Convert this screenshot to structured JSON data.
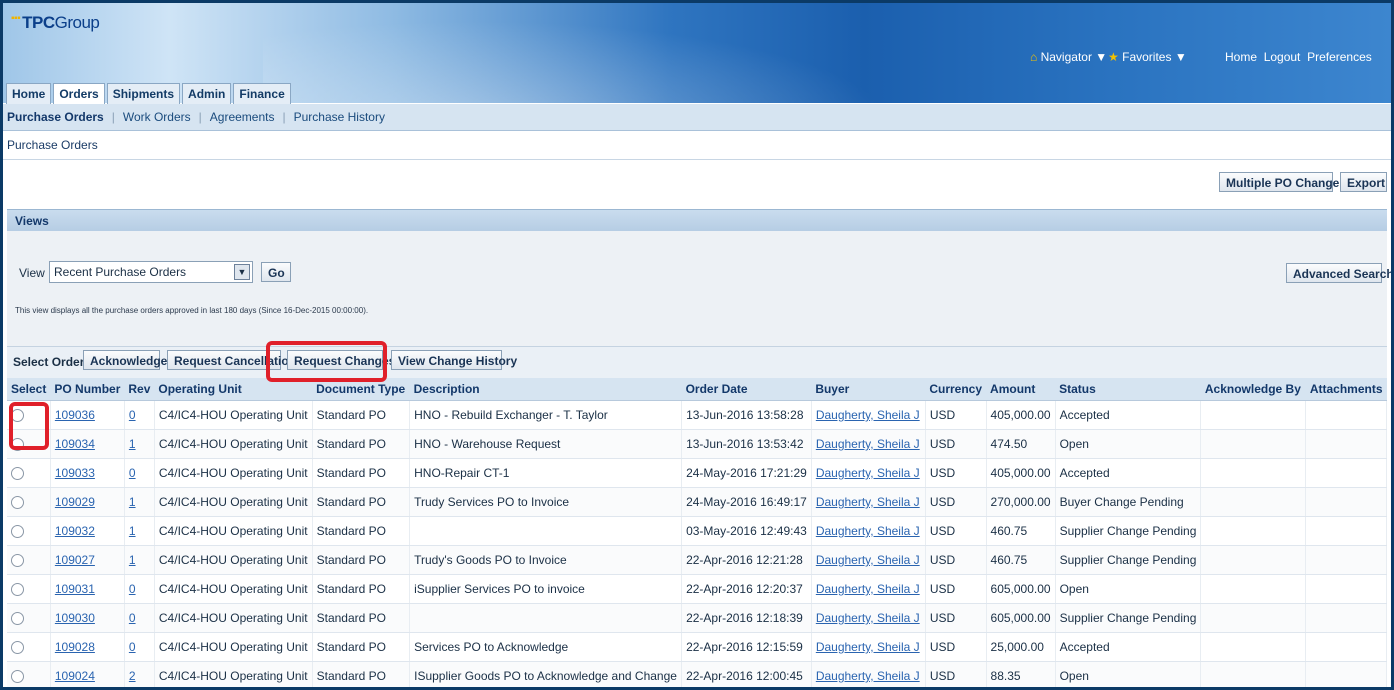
{
  "app": {
    "logo_text": "TPC",
    "logo_suffix": "Group",
    "navigator": "Navigator",
    "favorites": "Favorites",
    "global_links": [
      "Home",
      "Logout",
      "Preferences"
    ]
  },
  "tabs": [
    "Home",
    "Orders",
    "Shipments",
    "Admin",
    "Finance"
  ],
  "subnav": [
    "Purchase Orders",
    "Work Orders",
    "Agreements",
    "Purchase History"
  ],
  "page_title": "Purchase Orders",
  "actions": {
    "multiple_po_change": "Multiple PO Change",
    "export": "Export",
    "advanced_search": "Advanced Search"
  },
  "views": {
    "heading": "Views",
    "label": "View",
    "selected": "Recent Purchase Orders",
    "go": "Go",
    "help": "This view displays all the purchase orders approved in last 180 days (Since 16-Dec-2015 00:00:00)."
  },
  "select_order": {
    "label": "Select Order:",
    "acknowledge": "Acknowledge",
    "request_cancellation": "Request Cancellation",
    "request_changes": "Request Changes",
    "view_change_history": "View Change History"
  },
  "table": {
    "headers": [
      "Select",
      "PO Number",
      "Rev",
      "Operating Unit",
      "Document Type",
      "Description",
      "Order Date",
      "Buyer",
      "Currency",
      "Amount",
      "Status",
      "Acknowledge By",
      "Attachments"
    ],
    "rows": [
      {
        "po": "109036",
        "rev": "0",
        "ou": "C4/IC4-HOU Operating Unit",
        "type": "Standard PO",
        "desc": "HNO - Rebuild Exchanger - T. Taylor",
        "date": "13-Jun-2016 13:58:28",
        "buyer": "Daugherty, Sheila J",
        "cur": "USD",
        "amt": "405,000.00",
        "status": "Accepted"
      },
      {
        "po": "109034",
        "rev": "1",
        "ou": "C4/IC4-HOU Operating Unit",
        "type": "Standard PO",
        "desc": "HNO - Warehouse Request",
        "date": "13-Jun-2016 13:53:42",
        "buyer": "Daugherty, Sheila J",
        "cur": "USD",
        "amt": "474.50",
        "status": "Open"
      },
      {
        "po": "109033",
        "rev": "0",
        "ou": "C4/IC4-HOU Operating Unit",
        "type": "Standard PO",
        "desc": "HNO-Repair CT-1",
        "date": "24-May-2016 17:21:29",
        "buyer": "Daugherty, Sheila J",
        "cur": "USD",
        "amt": "405,000.00",
        "status": "Accepted"
      },
      {
        "po": "109029",
        "rev": "1",
        "ou": "C4/IC4-HOU Operating Unit",
        "type": "Standard PO",
        "desc": "Trudy Services PO to Invoice",
        "date": "24-May-2016 16:49:17",
        "buyer": "Daugherty, Sheila J",
        "cur": "USD",
        "amt": "270,000.00",
        "status": "Buyer Change Pending"
      },
      {
        "po": "109032",
        "rev": "1",
        "ou": "C4/IC4-HOU Operating Unit",
        "type": "Standard PO",
        "desc": "",
        "date": "03-May-2016 12:49:43",
        "buyer": "Daugherty, Sheila J",
        "cur": "USD",
        "amt": "460.75",
        "status": "Supplier Change Pending"
      },
      {
        "po": "109027",
        "rev": "1",
        "ou": "C4/IC4-HOU Operating Unit",
        "type": "Standard PO",
        "desc": "Trudy's Goods PO to Invoice",
        "date": "22-Apr-2016 12:21:28",
        "buyer": "Daugherty, Sheila J",
        "cur": "USD",
        "amt": "460.75",
        "status": "Supplier Change Pending"
      },
      {
        "po": "109031",
        "rev": "0",
        "ou": "C4/IC4-HOU Operating Unit",
        "type": "Standard PO",
        "desc": "iSupplier Services PO to invoice",
        "date": "22-Apr-2016 12:20:37",
        "buyer": "Daugherty, Sheila J",
        "cur": "USD",
        "amt": "605,000.00",
        "status": "Open"
      },
      {
        "po": "109030",
        "rev": "0",
        "ou": "C4/IC4-HOU Operating Unit",
        "type": "Standard PO",
        "desc": "",
        "date": "22-Apr-2016 12:18:39",
        "buyer": "Daugherty, Sheila J",
        "cur": "USD",
        "amt": "605,000.00",
        "status": "Supplier Change Pending"
      },
      {
        "po": "109028",
        "rev": "0",
        "ou": "C4/IC4-HOU Operating Unit",
        "type": "Standard PO",
        "desc": "Services PO to Acknowledge",
        "date": "22-Apr-2016 12:15:59",
        "buyer": "Daugherty, Sheila J",
        "cur": "USD",
        "amt": "25,000.00",
        "status": "Accepted"
      },
      {
        "po": "109024",
        "rev": "2",
        "ou": "C4/IC4-HOU Operating Unit",
        "type": "Standard PO",
        "desc": "ISupplier Goods PO to Acknowledge and Change",
        "date": "22-Apr-2016 12:00:45",
        "buyer": "Daugherty, Sheila J",
        "cur": "USD",
        "amt": "88.35",
        "status": "Open"
      }
    ]
  }
}
